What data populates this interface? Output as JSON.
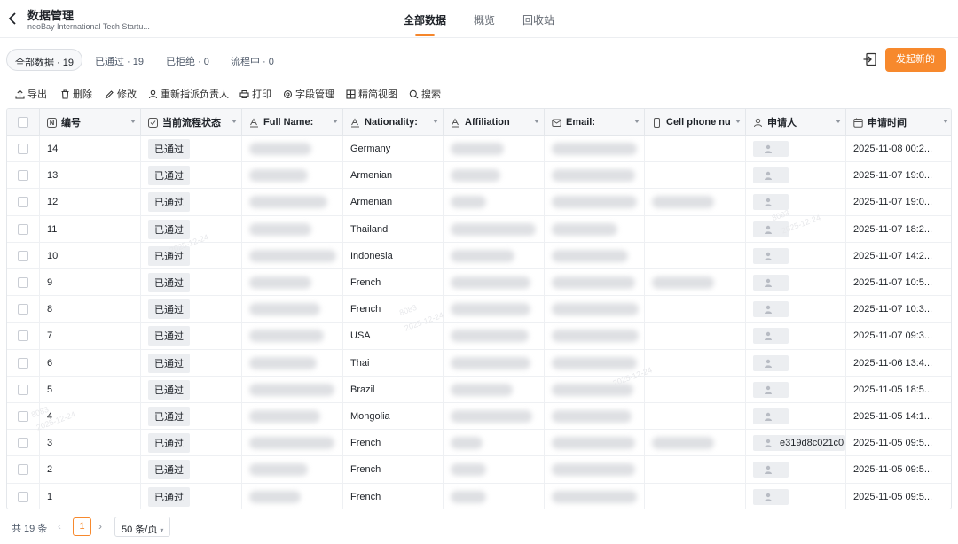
{
  "header": {
    "back_icon": "chevron-left-icon",
    "title": "数据管理",
    "subtitle": "neoBay International Tech Startu...",
    "tabs": [
      {
        "label": "全部数据",
        "active": true
      },
      {
        "label": "概览",
        "active": false
      },
      {
        "label": "回收站",
        "active": false
      }
    ]
  },
  "filters": {
    "all": "全部数据 · 19",
    "approved": "已通过 · 19",
    "rejected": "已拒绝 · 0",
    "in_process": "流程中 · 0"
  },
  "actions": {
    "export_icon": "exit-icon",
    "new_button": "发起新的",
    "accent_color": "#f7892d"
  },
  "toolbar": {
    "export": "导出",
    "delete": "删除",
    "edit": "修改",
    "reassign": "重新指派负责人",
    "print": "打印",
    "fields": "字段管理",
    "compact_view": "精简视图",
    "search": "搜索"
  },
  "table": {
    "columns": [
      "编号",
      "当前流程状态",
      "Full Name:",
      "Nationality:",
      "Affiliation",
      "Email:",
      "Cell phone nu",
      "申请人",
      "申请时间"
    ],
    "rows": [
      {
        "id": "14",
        "status": "已通过",
        "nationality": "Germany",
        "time": "2025-11-08 00:2...",
        "applicant": ""
      },
      {
        "id": "13",
        "status": "已通过",
        "nationality": "Armenian",
        "time": "2025-11-07 19:0...",
        "applicant": ""
      },
      {
        "id": "12",
        "status": "已通过",
        "nationality": "Armenian",
        "time": "2025-11-07 19:0...",
        "applicant": ""
      },
      {
        "id": "11",
        "status": "已通过",
        "nationality": "Thailand",
        "time": "2025-11-07 18:2...",
        "applicant": ""
      },
      {
        "id": "10",
        "status": "已通过",
        "nationality": "Indonesia",
        "time": "2025-11-07 14:2...",
        "applicant": ""
      },
      {
        "id": "9",
        "status": "已通过",
        "nationality": "French",
        "time": "2025-11-07 10:5...",
        "applicant": ""
      },
      {
        "id": "8",
        "status": "已通过",
        "nationality": "French",
        "time": "2025-11-07 10:3...",
        "applicant": ""
      },
      {
        "id": "7",
        "status": "已通过",
        "nationality": "USA",
        "time": "2025-11-07 09:3...",
        "applicant": ""
      },
      {
        "id": "6",
        "status": "已通过",
        "nationality": "Thai",
        "time": "2025-11-06 13:4...",
        "applicant": ""
      },
      {
        "id": "5",
        "status": "已通过",
        "nationality": "Brazil",
        "time": "2025-11-05 18:5...",
        "applicant": ""
      },
      {
        "id": "4",
        "status": "已通过",
        "nationality": "Mongolia",
        "time": "2025-11-05 14:1...",
        "applicant": ""
      },
      {
        "id": "3",
        "status": "已通过",
        "nationality": "French",
        "time": "2025-11-05 09:5...",
        "applicant": "e319d8c021c0"
      },
      {
        "id": "2",
        "status": "已通过",
        "nationality": "French",
        "time": "2025-11-05 09:5...",
        "applicant": ""
      },
      {
        "id": "1",
        "status": "已通过",
        "nationality": "French",
        "time": "2025-11-05 09:5...",
        "applicant": ""
      }
    ]
  },
  "pagination": {
    "total": "共 19 条",
    "current": "1",
    "page_size": "50 条/页"
  },
  "watermark": {
    "user": "8083",
    "date": "2025-12-24"
  }
}
